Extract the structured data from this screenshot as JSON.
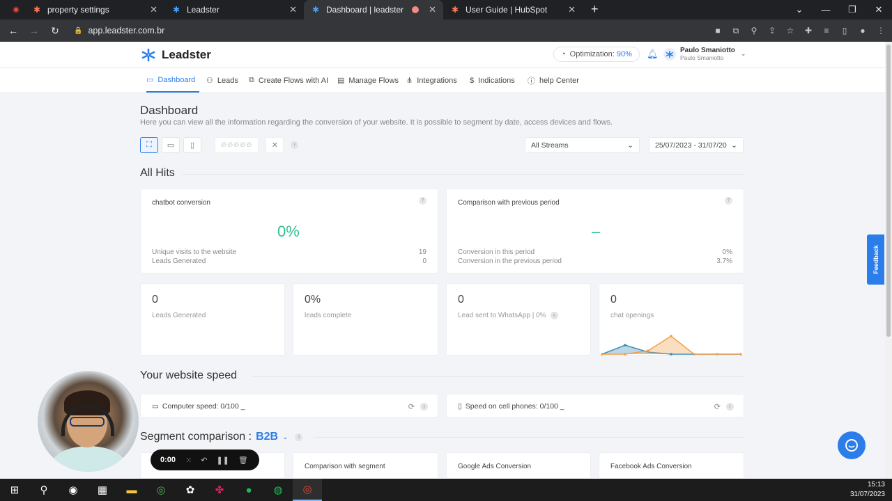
{
  "browser": {
    "tabs": [
      {
        "title": "property settings",
        "favicon": "hubspot-icon",
        "color": "#ff7a59"
      },
      {
        "title": "Leadster",
        "favicon": "leadster-icon",
        "color": "#2b7de9"
      },
      {
        "title": "Dashboard | leadster",
        "favicon": "leadster-icon",
        "color": "#2b7de9",
        "active": true
      },
      {
        "title": "User Guide | HubSpot",
        "favicon": "hubspot-icon",
        "color": "#ff7a59"
      }
    ],
    "url": "app.leadster.com.br"
  },
  "header": {
    "logo_text": "Leadster",
    "optimization_label": "Optimization:",
    "optimization_value": "90%",
    "user_name": "Paulo Smaniotto",
    "user_sub": "Paulo Smaniotto"
  },
  "menu": {
    "items": [
      {
        "label": "Dashboard",
        "icon": "monitor-icon",
        "active": true
      },
      {
        "label": "Leads",
        "icon": "users-icon"
      },
      {
        "label": "Create Flows with AI",
        "icon": "flow-ai-icon"
      },
      {
        "label": "Manage Flows",
        "icon": "chat-icon"
      },
      {
        "label": "Integrations",
        "icon": "share-icon"
      },
      {
        "label": "Indications",
        "icon": "dollar-icon"
      },
      {
        "label": "help Center",
        "icon": "help-icon"
      }
    ]
  },
  "page": {
    "title": "Dashboard",
    "description": "Here you can view all the information regarding the conversion of your website. It is possible to segment by date, access devices and flows.",
    "stream_select": "All Streams",
    "date_range": "25/07/2023 - 31/07/20"
  },
  "all_hits": {
    "section_title": "All Hits",
    "chatbot": {
      "title": "chatbot conversion",
      "value": "0%",
      "rows": [
        {
          "label": "Unique visits to the website",
          "value": "19"
        },
        {
          "label": "Leads Generated",
          "value": "0"
        }
      ]
    },
    "comparison": {
      "title": "Comparison with previous period",
      "value": "–",
      "rows": [
        {
          "label": "Conversion in this period",
          "value": "0%"
        },
        {
          "label": "Conversion in the previous period",
          "value": "3.7%"
        }
      ]
    },
    "small_cards": [
      {
        "value": "0",
        "label": "Leads Generated"
      },
      {
        "value": "0%",
        "label": "leads complete"
      },
      {
        "value": "0",
        "label": "Lead sent to WhatsApp | 0%"
      },
      {
        "value": "0",
        "label": "chat openings"
      }
    ]
  },
  "speed": {
    "section_title": "Your website speed",
    "computer": "Computer speed: 0/100 _",
    "mobile": "Speed on cell phones: 0/100 _"
  },
  "segment": {
    "label": "Segment comparison :",
    "value": "B2B",
    "cards": [
      "Comparison with segment",
      "Google Ads Conversion",
      "Facebook Ads Conversion"
    ]
  },
  "widgets": {
    "feedback": "Feedback",
    "recorder_time": "0:00"
  },
  "taskbar": {
    "time": "15:13",
    "date": "31/07/2023"
  },
  "colors": {
    "accent": "#2b7de9",
    "success": "#2fbf8f",
    "chart_orange": "#f0a04b",
    "chart_blue": "#3c8bb5"
  }
}
